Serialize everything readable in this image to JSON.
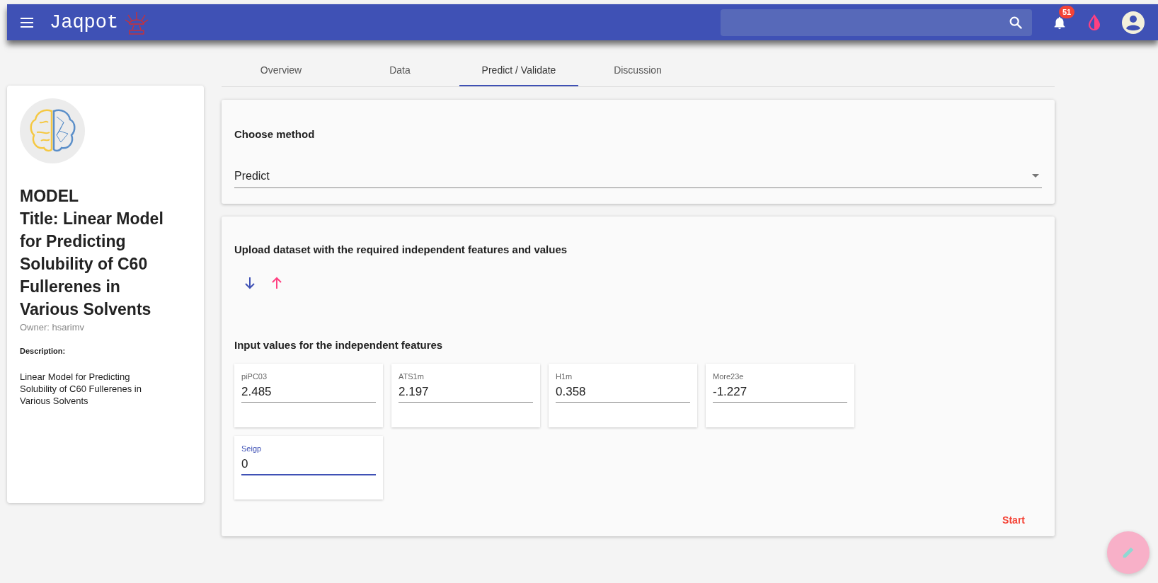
{
  "app_bar": {
    "brand": "Jaqpot",
    "notifications": {
      "count": "51"
    }
  },
  "tabs": [
    {
      "label": "Overview",
      "selected": false
    },
    {
      "label": "Data",
      "selected": false
    },
    {
      "label": "Predict / Validate",
      "selected": true
    },
    {
      "label": "Discussion",
      "selected": false
    }
  ],
  "model_card": {
    "heading": "MODEL",
    "title": "Title: Linear Model for Predicting Solubility of C60 Fullerenes in Various Solvents",
    "owner": "Owner: hsarimv",
    "description_label": "Description:",
    "description": "Linear Model for Predicting Solubility of C60 Fullerenes in Various Solvents"
  },
  "method_card": {
    "title": "Choose method",
    "select": {
      "value": "Predict"
    }
  },
  "upload_card": {
    "title": "Upload dataset with the required independent features and values",
    "inputs_title": "Input values for the independent features",
    "features": [
      {
        "label": "piPC03",
        "value": "2.485",
        "focused": false
      },
      {
        "label": "ATS1m",
        "value": "2.197",
        "focused": false
      },
      {
        "label": "H1m",
        "value": "0.358",
        "focused": false
      },
      {
        "label": "More23e",
        "value": "-1.227",
        "focused": false
      },
      {
        "label": "Seigp",
        "value": "0",
        "focused": true
      }
    ],
    "start_button": "Start"
  }
}
